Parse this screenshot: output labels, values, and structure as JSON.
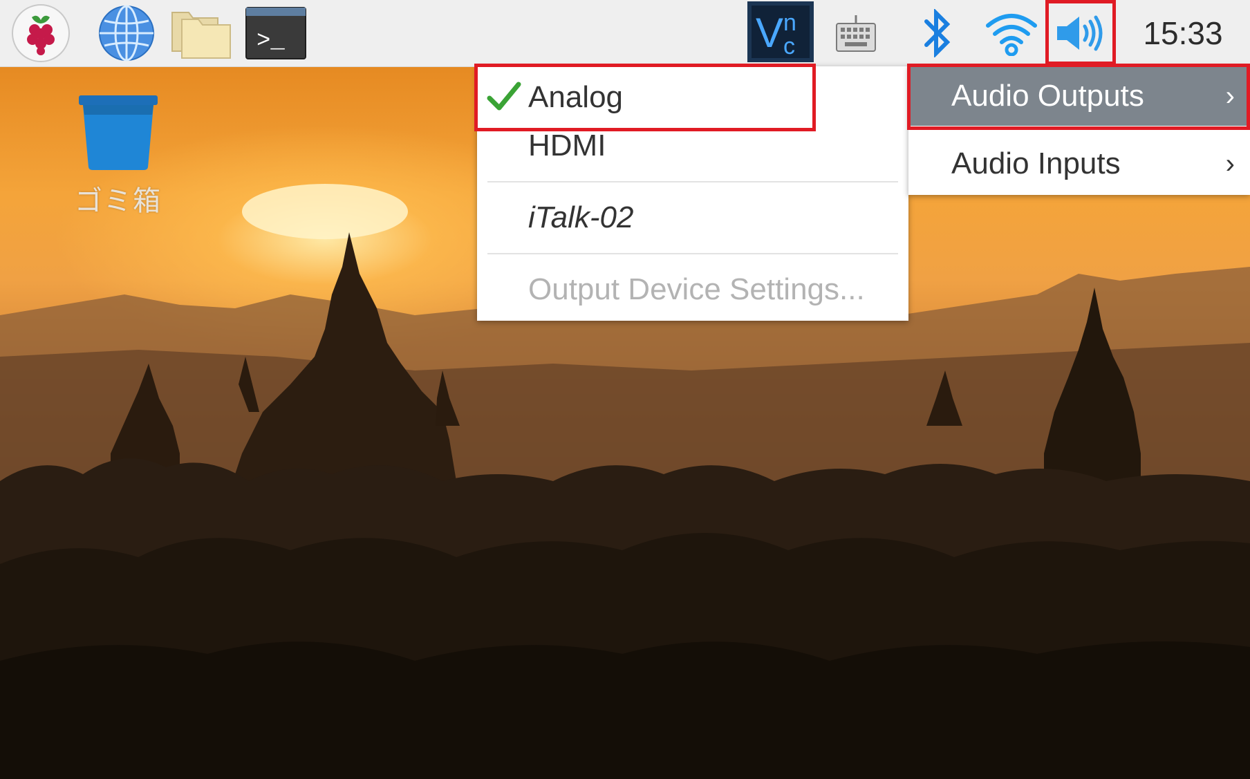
{
  "taskbar": {
    "clock": "15:33",
    "icons": {
      "menu": "raspberry-pi-icon",
      "browser": "globe-icon",
      "files": "folder-icon",
      "terminal": "terminal-icon",
      "vnc": "vnc-icon",
      "keyboard": "keyboard-icon",
      "bluetooth": "bluetooth-icon",
      "wifi": "wifi-icon",
      "volume": "volume-icon"
    },
    "vnc_label": "Vnc",
    "terminal_prompt": ">_"
  },
  "desktop": {
    "trash_label": "ゴミ箱"
  },
  "output_menu": {
    "items": [
      {
        "label": "Analog",
        "checked": true
      },
      {
        "label": "HDMI",
        "checked": false
      },
      {
        "label": "iTalk-02",
        "checked": false
      },
      {
        "label": "Output Device Settings...",
        "disabled": true
      }
    ]
  },
  "volume_menu": {
    "items": [
      {
        "label": "Audio Outputs",
        "chevron": "›",
        "active": true
      },
      {
        "label": "Audio Inputs",
        "chevron": "›",
        "active": false
      }
    ]
  },
  "colors": {
    "highlight": "#e01b24",
    "menu_active_bg": "#7d858d",
    "checkmark": "#3aa335",
    "volume_icon": "#2f9bea",
    "bluetooth": "#1a7fe0"
  }
}
